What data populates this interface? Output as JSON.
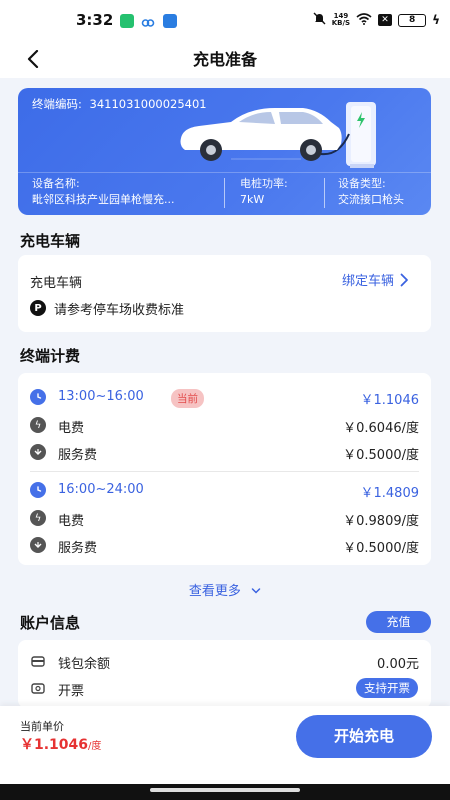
{
  "status_bar": {
    "time": "3:32",
    "net_speed_top": "149",
    "net_speed_bottom": "KB/S",
    "battery": "8"
  },
  "header": {
    "title": "充电准备"
  },
  "terminal": {
    "code_label": "终端编码:",
    "code_value": "3411031000025401",
    "device_name_label": "设备名称:",
    "device_name_value": "毗邻区科技产业园单枪慢充...",
    "power_label": "电桩功率:",
    "power_value": "7kW",
    "device_type_label": "设备类型:",
    "device_type_value": "交流接口枪头"
  },
  "vehicle_section": {
    "title": "充电车辆",
    "row_label": "充电车辆",
    "bind_link": "绑定车辆",
    "parking_note": "请参考停车场收费标准"
  },
  "billing_section": {
    "title": "终端计费",
    "periods": [
      {
        "time": "13:00~16:00",
        "badge": "当前",
        "total": "￥1.1046",
        "electricity_label": "电费",
        "electricity_value": "￥0.6046/度",
        "service_label": "服务费",
        "service_value": "￥0.5000/度"
      },
      {
        "time": "16:00~24:00",
        "total": "￥1.4809",
        "electricity_label": "电费",
        "electricity_value": "￥0.9809/度",
        "service_label": "服务费",
        "service_value": "￥0.5000/度"
      }
    ],
    "more_link": "查看更多"
  },
  "account_section": {
    "title": "账户信息",
    "recharge_button": "充值",
    "wallet_label": "钱包余额",
    "wallet_value": "0.00元",
    "invoice_label": "开票",
    "invoice_tag": "支持开票"
  },
  "bottom_bar": {
    "price_label": "当前单价",
    "price_value": "￥1.1046",
    "price_unit": "/度",
    "start_button": "开始充电"
  },
  "colors": {
    "accent": "#4570e8",
    "price_red": "#e63232",
    "badge_bg": "#f6c3c3"
  }
}
